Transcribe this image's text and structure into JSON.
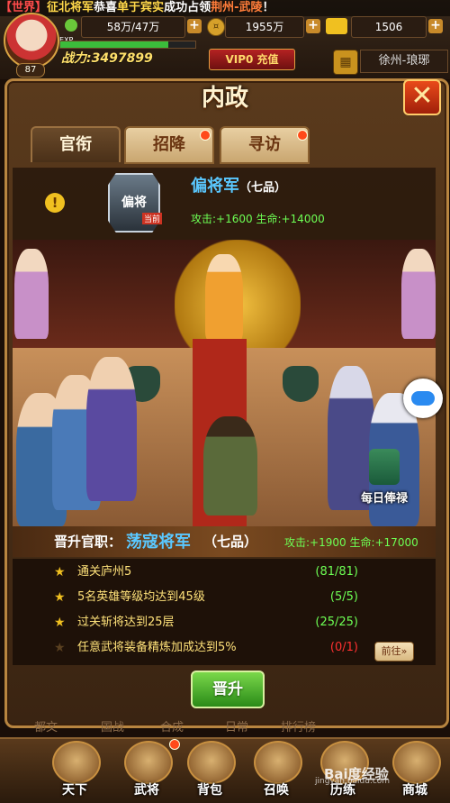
{
  "ticker": {
    "tag": "【世界】",
    "headline": "征北将军",
    "pre": "恭喜",
    "name": "单于宾实",
    "mid": "成功占领",
    "location": "荆州-武陵",
    "end": "！"
  },
  "player": {
    "level": "87",
    "food": "58万/47万",
    "silver": "1955万",
    "gold": "1506",
    "exp_label": "EXP",
    "exp_percent": 80,
    "power": "战力:3497899",
    "vip_label": "VIP0 充值",
    "city": "徐州-琅琊"
  },
  "panel": {
    "title": "内政",
    "close_label": "✕",
    "tabs": [
      {
        "label": "官衔",
        "active": true
      },
      {
        "label": "招降",
        "active": false
      },
      {
        "label": "寻访",
        "active": false
      }
    ]
  },
  "current": {
    "badge_text": "偏将",
    "badge_sub": "当前",
    "title": "偏将军",
    "rank": "（七品）",
    "stats": "攻击:+1600  生命:+14000"
  },
  "side": {
    "daily_label": "每日俸禄"
  },
  "promotion": {
    "label": "晋升官职：",
    "title": "荡寇将军",
    "rank": "（七品）",
    "stats": "攻击:+1900  生命:+17000"
  },
  "requirements": [
    {
      "text": "通关庐州5",
      "progress": "(81/81)",
      "done": true
    },
    {
      "text": "5名英雄等级均达到45级",
      "progress": "(5/5)",
      "done": true
    },
    {
      "text": "过关斩将达到25层",
      "progress": "(25/25)",
      "done": true
    },
    {
      "text": "任意武将装备精炼加成达到5%",
      "progress": "(0/1)",
      "done": false
    }
  ],
  "goto_label": "前往»",
  "promote_button": "晋升",
  "ghost_tabs": [
    "都文",
    "国战",
    "合成",
    "日常",
    "排行榜"
  ],
  "nav": [
    {
      "label": "天下"
    },
    {
      "label": "武将"
    },
    {
      "label": "背包"
    },
    {
      "label": "召唤"
    },
    {
      "label": "历练"
    },
    {
      "label": "商城"
    }
  ],
  "watermark": "Bai度经验",
  "watermark_url": "jingyan.baidu.com"
}
